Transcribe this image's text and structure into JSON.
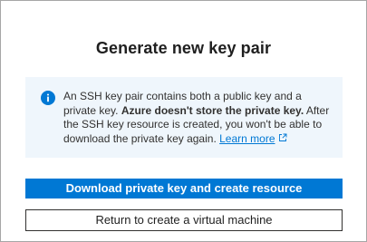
{
  "dialog": {
    "title": "Generate new key pair",
    "info": {
      "icon": "info-icon",
      "text_before": "An SSH key pair contains both a public key and a private key. ",
      "text_bold": "Azure doesn't store the private key.",
      "text_after": " After the SSH key resource is created, you won't be able to download the private key again. ",
      "link_label": "Learn more",
      "link_icon": "external-link-icon"
    },
    "buttons": {
      "primary_label": "Download private key and create resource",
      "secondary_label": "Return to create a virtual machine"
    }
  },
  "colors": {
    "accent": "#0078d4",
    "info_background": "#eff6fc",
    "text": "#323130"
  }
}
